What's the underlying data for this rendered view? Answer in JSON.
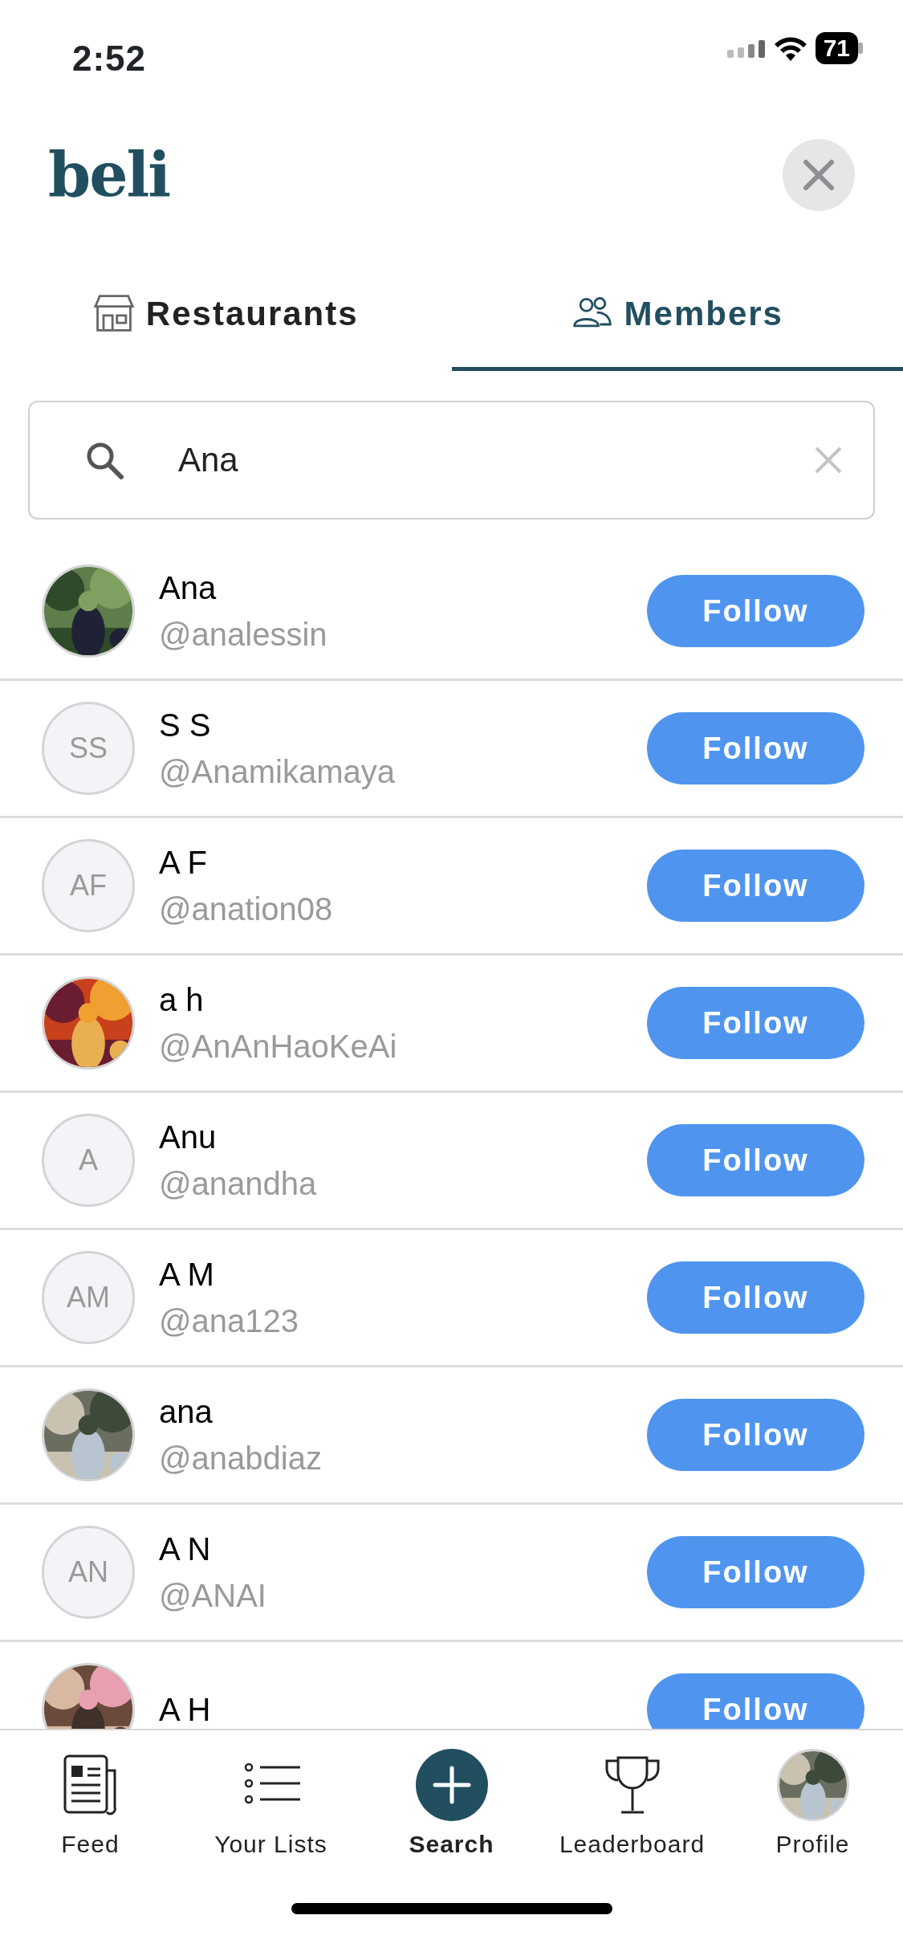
{
  "status_bar": {
    "time": "2:52",
    "battery": "71"
  },
  "header": {
    "logo": "beli"
  },
  "tabs": [
    {
      "label": "Restaurants",
      "kind": "store",
      "selected": false
    },
    {
      "label": "Members",
      "kind": "people",
      "selected": true
    }
  ],
  "search": {
    "value": "Ana"
  },
  "members": [
    {
      "name": "Ana",
      "handle": "@analessin",
      "button": "Follow"
    },
    {
      "name": "S S",
      "handle": "@Anamikamaya",
      "avatar": {
        "kind": "initials",
        "text": "SS"
      },
      "button": "Follow"
    },
    {
      "name": "A F",
      "handle": "@anation08",
      "avatar": {
        "kind": "initials",
        "text": "AF"
      },
      "button": "Follow"
    },
    {
      "name": "a h",
      "handle": "@AnAnHaoKeAi",
      "button": "Follow"
    },
    {
      "name": "Anu",
      "handle": "@anandha",
      "avatar": {
        "kind": "initials",
        "text": "A"
      },
      "button": "Follow"
    },
    {
      "name": "A M",
      "handle": "@ana123",
      "avatar": {
        "kind": "initials",
        "text": "AM"
      },
      "button": "Follow"
    },
    {
      "name": "ana",
      "handle": "@anabdiaz",
      "button": "Follow"
    },
    {
      "name": "A N",
      "handle": "@ANAI",
      "avatar": {
        "kind": "initials",
        "text": "AN"
      },
      "button": "Follow"
    },
    {
      "name": "A H",
      "button": "Follow"
    }
  ],
  "bottom_nav": [
    {
      "label": "Feed",
      "kind": "feed",
      "selected": false
    },
    {
      "label": "Your Lists",
      "kind": "lists",
      "selected": false
    },
    {
      "label": "Search",
      "kind": "search",
      "selected": true
    },
    {
      "label": "Leaderboard",
      "kind": "trophy",
      "selected": false
    },
    {
      "label": "Profile",
      "kind": "profile",
      "selected": false
    }
  ]
}
